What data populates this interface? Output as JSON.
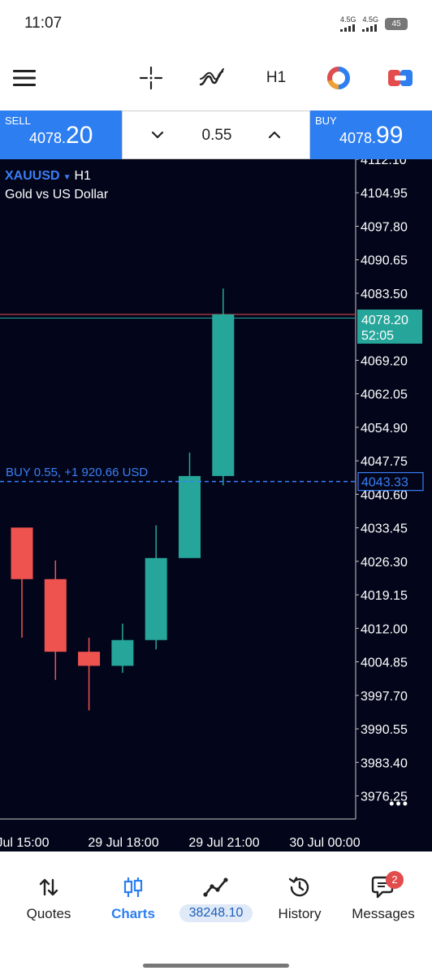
{
  "status": {
    "time": "11:07",
    "signal1": "4.5G",
    "signal2": "4.5G",
    "battery": "45"
  },
  "toolbar": {
    "timeframe": "H1"
  },
  "trade": {
    "sell_label": "SELL",
    "sell_price_main": "4078.",
    "sell_price_big": "20",
    "buy_label": "BUY",
    "buy_price_main": "4078.",
    "buy_price_big": "99",
    "lot": "0.55"
  },
  "chart": {
    "symbol": "XAUUSD",
    "timeframe": "H1",
    "description": "Gold vs US Dollar",
    "position_label": "BUY 0.55,  +1 920.66 USD",
    "price_tag": "4078.20",
    "timer": "52:05",
    "entry_tag": "4043.33"
  },
  "chart_data": {
    "type": "candlestick",
    "y_ticks": [
      "4112.10",
      "4104.95",
      "4097.80",
      "4090.65",
      "4083.50",
      "4069.20",
      "4062.05",
      "4054.90",
      "4047.75",
      "4040.60",
      "4033.45",
      "4026.30",
      "4019.15",
      "4012.00",
      "4004.85",
      "3997.70",
      "3990.55",
      "3983.40",
      "3976.25"
    ],
    "y_range": [
      3972.7,
      4112.1
    ],
    "x_labels": [
      "Jul 15:00",
      "29 Jul 18:00",
      "29 Jul 21:00",
      "30 Jul 00:00"
    ],
    "candles": [
      {
        "open": 4033.5,
        "high": 4033.5,
        "low": 4010.0,
        "close": 4022.5
      },
      {
        "open": 4022.5,
        "high": 4026.5,
        "low": 4001.0,
        "close": 4007.0
      },
      {
        "open": 4007.0,
        "high": 4010.0,
        "low": 3994.5,
        "close": 4004.0
      },
      {
        "open": 4004.0,
        "high": 4013.0,
        "low": 4002.5,
        "close": 4009.5
      },
      {
        "open": 4009.5,
        "high": 4034.0,
        "low": 4007.5,
        "close": 4027.0
      },
      {
        "open": 4027.0,
        "high": 4049.5,
        "low": 4027.0,
        "close": 4044.5
      },
      {
        "open": 4044.5,
        "high": 4084.5,
        "low": 4042.5,
        "close": 4079.0
      }
    ],
    "bid": 4078.2,
    "ask": 4078.99,
    "position_price": 4043.33,
    "colors": {
      "up": "#26a69a",
      "down": "#ef5350",
      "background": "#03061a",
      "position": "#3a7ff6",
      "ask_line": "#e05050",
      "bid_line": "#26a69a"
    }
  },
  "nav": {
    "items": [
      {
        "label": "Quotes"
      },
      {
        "label": "Charts"
      },
      {
        "label": "38248.10"
      },
      {
        "label": "History"
      },
      {
        "label": "Messages"
      }
    ],
    "badge": "2"
  },
  "icons": [
    "menu-icon",
    "crosshair-icon",
    "indicators-icon",
    "chart-type-icon",
    "trade-icon",
    "chevron-down-icon",
    "chevron-up-icon",
    "quotes-icon",
    "charts-icon",
    "trade-chart-icon",
    "history-icon",
    "messages-icon"
  ]
}
